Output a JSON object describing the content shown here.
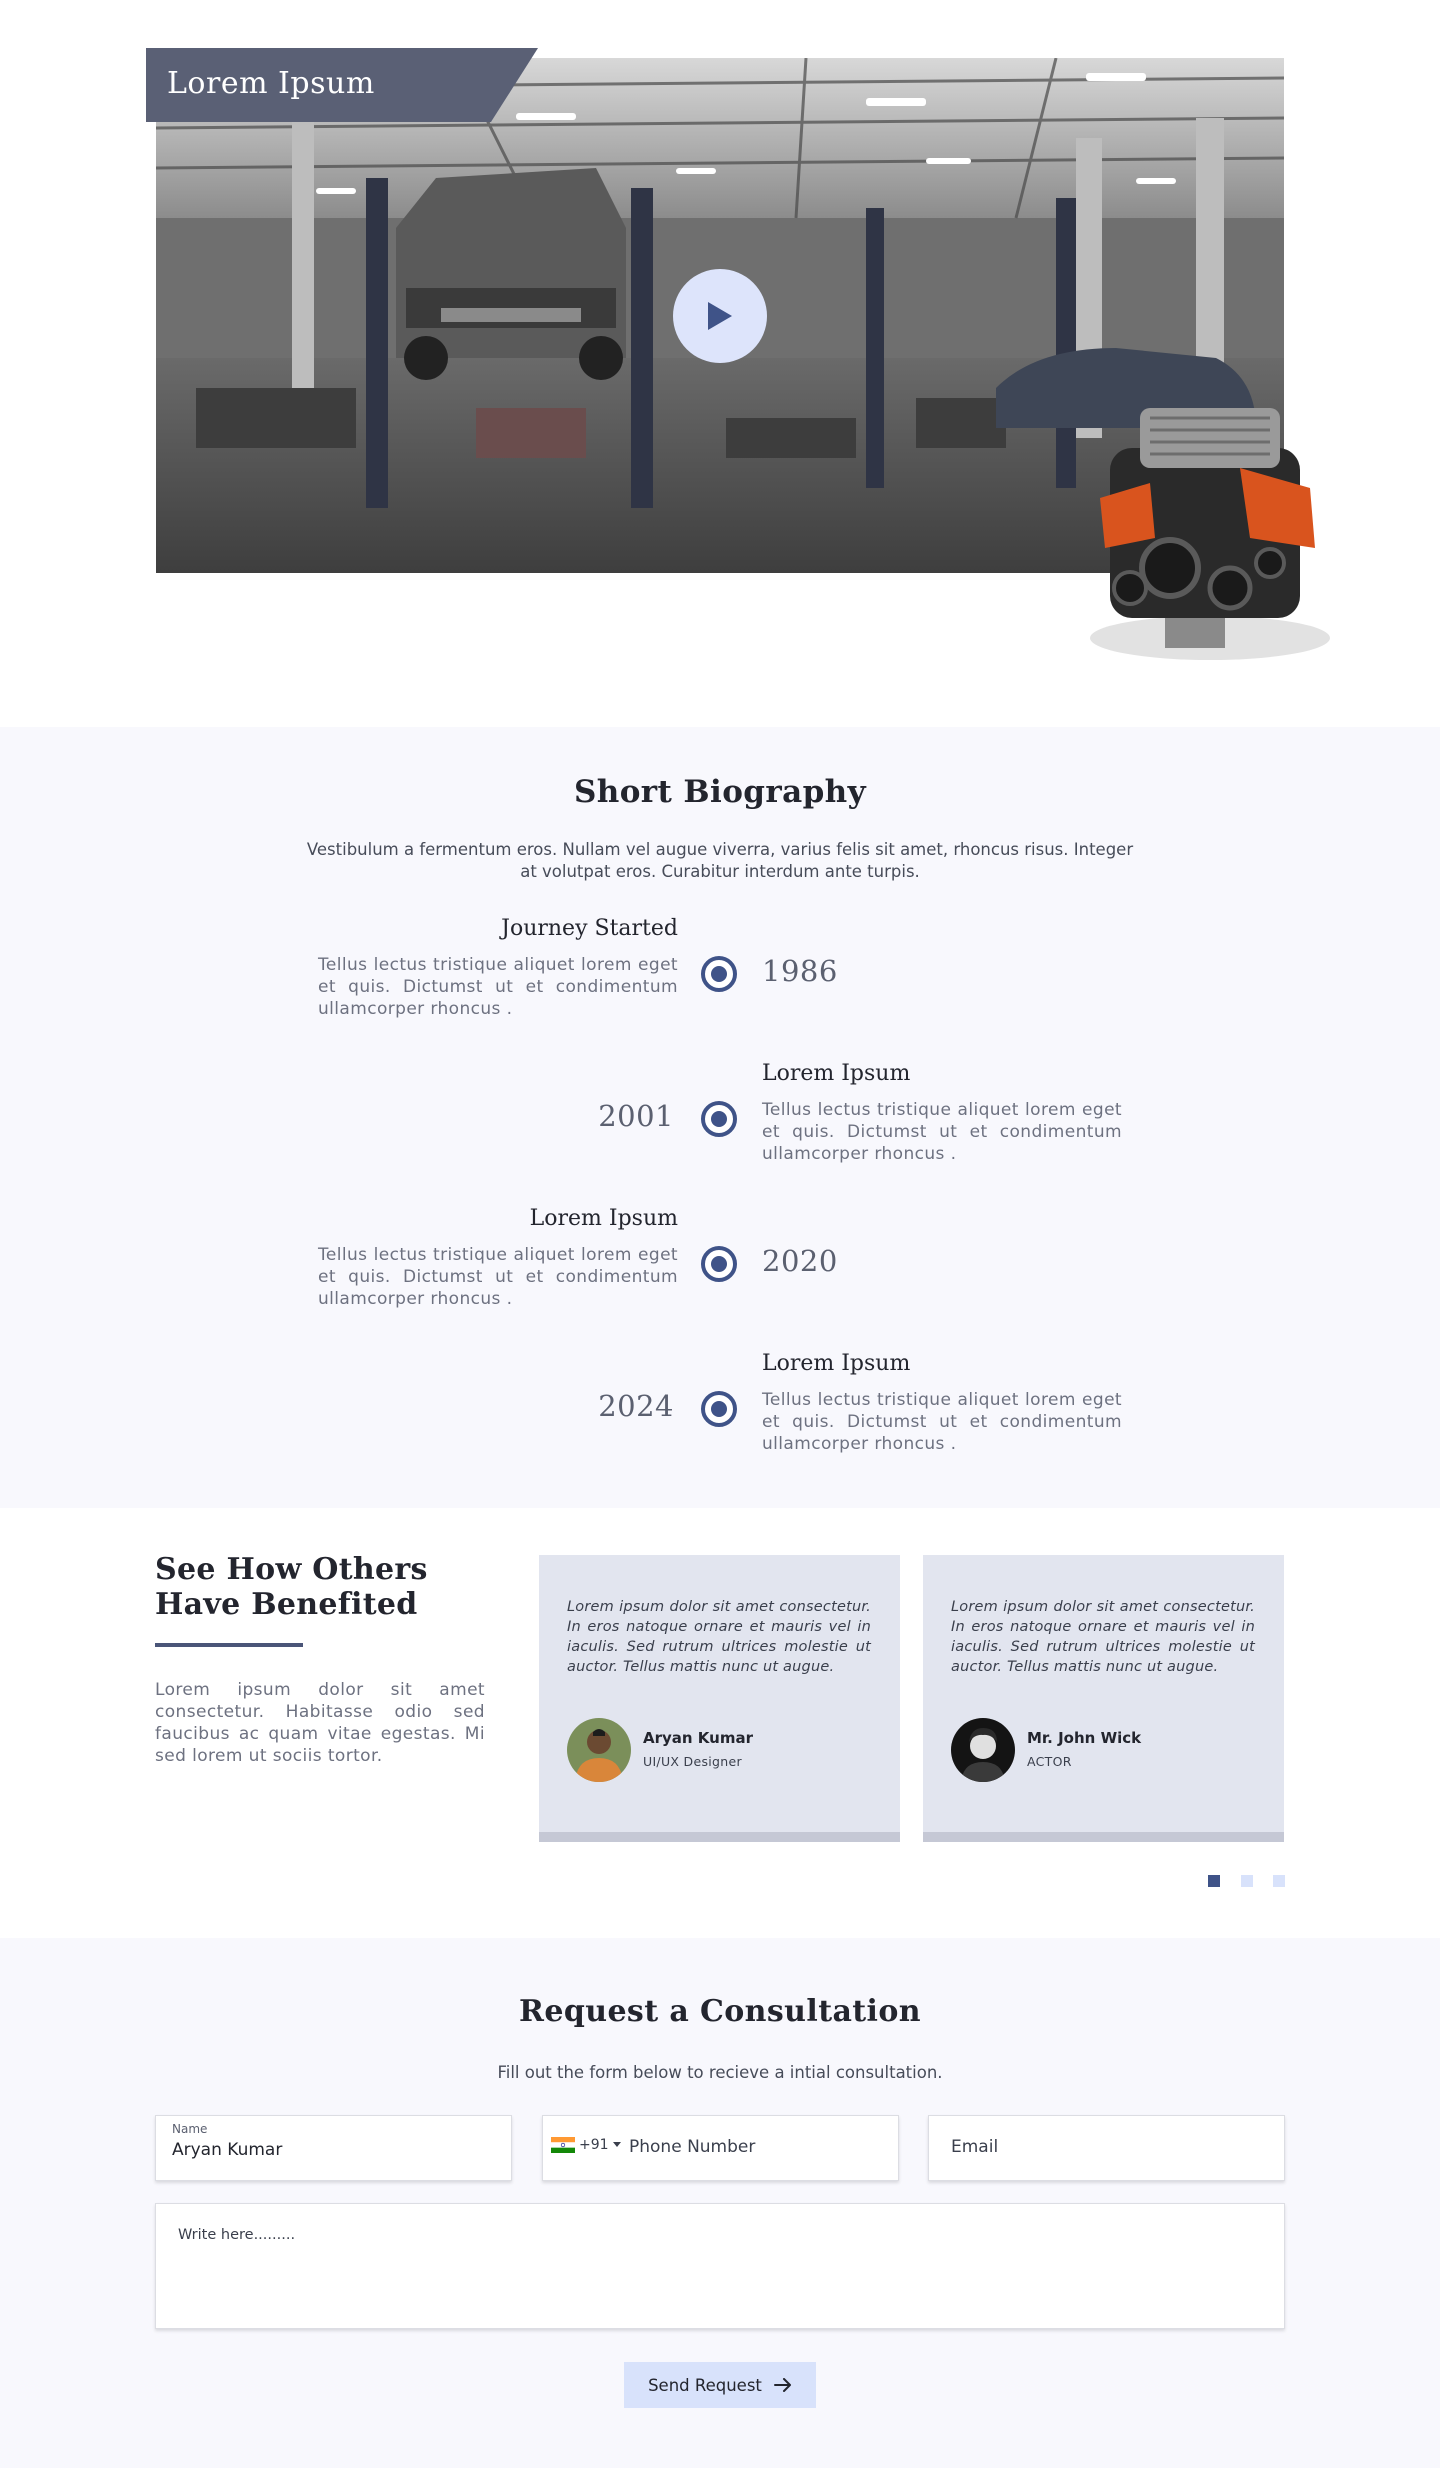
{
  "hero": {
    "tag_label": "Lorem Ipsum",
    "play_icon": "play-icon",
    "colors": {
      "tag_bg": "#5a6075",
      "play_bg": "#dde4fb",
      "play_icon": "#3f5388"
    }
  },
  "bio": {
    "title": "Short Biography",
    "intro": "Vestibulum a fermentum eros. Nullam vel augue viverra, varius felis sit amet, rhoncus risus. Integer at volutpat eros. Curabitur interdum ante turpis.",
    "items": [
      {
        "heading": "Journey Started",
        "year": "1986",
        "text": "Tellus lectus tristique aliquet lorem eget et quis. Dictumst ut et condimentum ullamcorper rhoncus ."
      },
      {
        "heading": "Lorem Ipsum",
        "year": "2001",
        "text": "Tellus lectus tristique aliquet lorem eget et quis. Dictumst ut et condimentum ullamcorper rhoncus ."
      },
      {
        "heading": "Lorem Ipsum",
        "year": "2020",
        "text": "Tellus lectus tristique aliquet lorem eget et quis. Dictumst ut et condimentum ullamcorper rhoncus ."
      },
      {
        "heading": "Lorem Ipsum",
        "year": "2024",
        "text": "Tellus lectus tristique aliquet lorem eget et quis. Dictumst ut et condimentum ullamcorper rhoncus ."
      }
    ],
    "colors": {
      "node": "#3f5388"
    }
  },
  "testimonials": {
    "title": "See How Others Have Benefited",
    "text": "Lorem ipsum dolor sit amet consectetur. Habitasse odio sed faucibus ac quam vitae egestas. Mi sed lorem ut sociis tortor.",
    "cards": [
      {
        "quote": "Lorem ipsum dolor sit amet consectetur. In eros natoque ornare et mauris vel in iaculis. Sed rutrum ultrices molestie ut auctor. Tellus mattis nunc ut augue.",
        "name": "Aryan Kumar",
        "role": "UI/UX Designer"
      },
      {
        "quote": "Lorem ipsum dolor sit amet consectetur. In eros natoque ornare et mauris vel in iaculis. Sed rutrum ultrices molestie ut auctor. Tellus mattis nunc ut augue.",
        "name": "Mr. John Wick",
        "role": "ACTOR"
      }
    ],
    "pagination": {
      "active_index": 0,
      "count": 3
    },
    "colors": {
      "dot_active": "#3f5388",
      "dot_inactive": "#d8e2fb"
    }
  },
  "consultation": {
    "title": "Request a Consultation",
    "subtitle": "Fill out the form below to recieve a intial consultation.",
    "name_field": {
      "label": "Name",
      "value": "Aryan Kumar"
    },
    "phone_field": {
      "country_code": "+91",
      "flag_icon": "india-flag-icon",
      "placeholder": "Phone Number"
    },
    "email_field": {
      "placeholder": "Email"
    },
    "message_field": {
      "placeholder": "Write here........."
    },
    "send_button": {
      "label": "Send Request",
      "icon": "arrow-right-icon"
    },
    "colors": {
      "button_bg": "#d8e2fb"
    }
  }
}
